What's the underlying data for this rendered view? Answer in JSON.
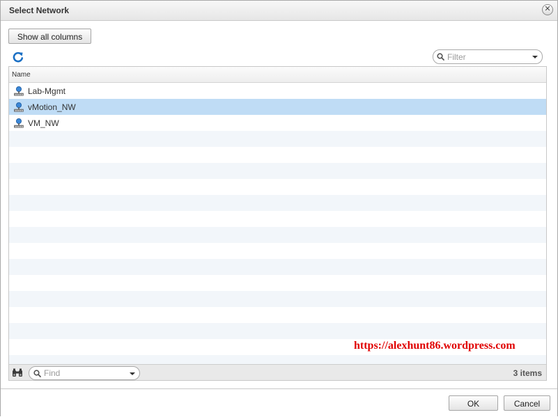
{
  "dialog": {
    "title": "Select Network",
    "close_glyph": "✕",
    "close_icon": "close-circle-icon"
  },
  "toolbar": {
    "show_all_columns_label": "Show all columns",
    "refresh_icon": "refresh-icon",
    "filter_placeholder": "Filter"
  },
  "grid": {
    "columns": [
      "Name"
    ],
    "rows": [
      {
        "name": "Lab-Mgmt",
        "icon": "network-portgroup-icon",
        "selected": false
      },
      {
        "name": "vMotion_NW",
        "icon": "network-portgroup-icon",
        "selected": true
      },
      {
        "name": "VM_NW",
        "icon": "network-portgroup-icon",
        "selected": false
      }
    ]
  },
  "footer": {
    "find_placeholder": "Find",
    "item_count": "3 items",
    "binoculars_icon": "binoculars-icon"
  },
  "watermark": "https://alexhunt86.wordpress.com",
  "actions": {
    "ok_label": "OK",
    "cancel_label": "Cancel"
  },
  "colors": {
    "selection": "#bfdcf5",
    "stripe": "#f2f6fa",
    "watermark": "#e00000",
    "refresh": "#1a6fc4"
  }
}
